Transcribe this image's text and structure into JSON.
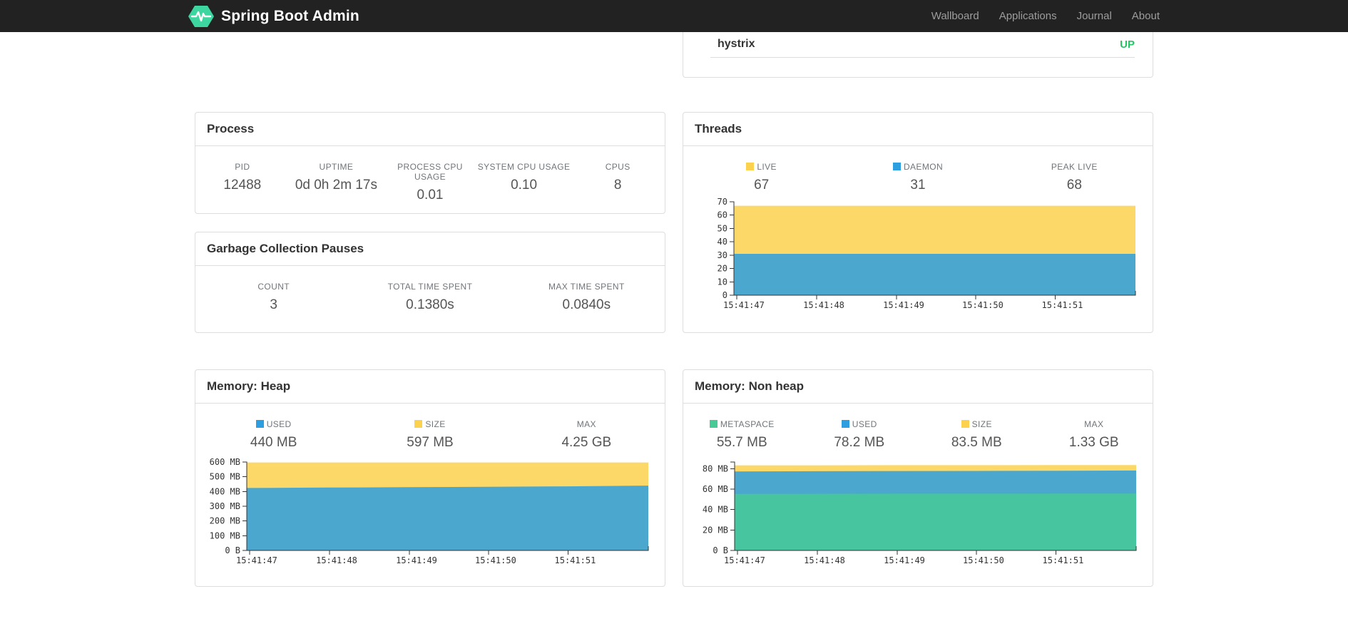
{
  "navbar": {
    "brand": "Spring Boot Admin",
    "items": [
      {
        "label": "Wallboard"
      },
      {
        "label": "Applications"
      },
      {
        "label": "Journal"
      },
      {
        "label": "About"
      }
    ]
  },
  "application_row": {
    "name": "hystrix",
    "status": "UP",
    "status_color": "#27C465"
  },
  "panels": {
    "process": {
      "title": "Process",
      "stats": [
        {
          "label": "PID",
          "value": "12488"
        },
        {
          "label": "UPTIME",
          "value": "0d 0h 2m 17s"
        },
        {
          "label": "PROCESS CPU USAGE",
          "value": "0.01"
        },
        {
          "label": "SYSTEM CPU USAGE",
          "value": "0.10"
        },
        {
          "label": "CPUS",
          "value": "8"
        }
      ]
    },
    "gc": {
      "title": "Garbage Collection Pauses",
      "stats": [
        {
          "label": "COUNT",
          "value": "3"
        },
        {
          "label": "TOTAL TIME SPENT",
          "value": "0.1380s"
        },
        {
          "label": "MAX TIME SPENT",
          "value": "0.0840s"
        }
      ]
    },
    "threads": {
      "title": "Threads",
      "stats": [
        {
          "label": "LIVE",
          "value": "67",
          "color": "#FBD14E"
        },
        {
          "label": "DAEMON",
          "value": "31",
          "color": "#2D9FE0"
        },
        {
          "label": "PEAK LIVE",
          "value": "68"
        }
      ]
    },
    "heap": {
      "title": "Memory: Heap",
      "stats": [
        {
          "label": "USED",
          "value": "440 MB",
          "color": "#2D9FE0"
        },
        {
          "label": "SIZE",
          "value": "597 MB",
          "color": "#FBD14E"
        },
        {
          "label": "MAX",
          "value": "4.25 GB"
        }
      ]
    },
    "nonheap": {
      "title": "Memory: Non heap",
      "stats": [
        {
          "label": "METASPACE",
          "value": "55.7 MB",
          "color": "#47CA95"
        },
        {
          "label": "USED",
          "value": "78.2 MB",
          "color": "#2D9FE0"
        },
        {
          "label": "SIZE",
          "value": "83.5 MB",
          "color": "#FBD14E"
        },
        {
          "label": "MAX",
          "value": "1.33 GB"
        }
      ]
    }
  },
  "chart_data": [
    {
      "id": "threads",
      "type": "area",
      "title": "Threads",
      "x_labels": [
        "15:41:47",
        "15:41:48",
        "15:41:49",
        "15:41:50",
        "15:41:51"
      ],
      "tick_fracs": [
        0.007,
        0.206,
        0.405,
        0.602,
        0.8
      ],
      "ylim": [
        0,
        70
      ],
      "yticks": [
        {
          "v": 0,
          "label": "0"
        },
        {
          "v": 10,
          "label": "10"
        },
        {
          "v": 20,
          "label": "20"
        },
        {
          "v": 30,
          "label": "30"
        },
        {
          "v": 40,
          "label": "40"
        },
        {
          "v": 50,
          "label": "50"
        },
        {
          "v": 60,
          "label": "60"
        },
        {
          "v": 70,
          "label": "70"
        }
      ],
      "grid": false,
      "legend_position": "above",
      "series": [
        {
          "name": "LIVE",
          "color": "#FBD14E",
          "values": [
            67,
            67,
            67,
            67,
            67,
            67
          ]
        },
        {
          "name": "DAEMON",
          "color": "#2D9FE0",
          "values": [
            31,
            31,
            31,
            31,
            31,
            31
          ]
        }
      ]
    },
    {
      "id": "heap",
      "type": "area",
      "title": "Memory: Heap",
      "x_labels": [
        "15:41:47",
        "15:41:48",
        "15:41:49",
        "15:41:50",
        "15:41:51"
      ],
      "tick_fracs": [
        0.007,
        0.206,
        0.405,
        0.602,
        0.8
      ],
      "ylim": [
        0,
        600
      ],
      "yticks": [
        {
          "v": 0,
          "label": "0 B"
        },
        {
          "v": 100,
          "label": "100 MB"
        },
        {
          "v": 200,
          "label": "200 MB"
        },
        {
          "v": 300,
          "label": "300 MB"
        },
        {
          "v": 400,
          "label": "400 MB"
        },
        {
          "v": 500,
          "label": "500 MB"
        },
        {
          "v": 600,
          "label": "600 MB"
        }
      ],
      "grid": false,
      "legend_position": "above",
      "series": [
        {
          "name": "SIZE",
          "color": "#FBD14E",
          "values": [
            597,
            597,
            597,
            597,
            597,
            597
          ]
        },
        {
          "name": "USED",
          "color": "#2D9FE0",
          "values": [
            424,
            427,
            429,
            432,
            435,
            440
          ]
        }
      ]
    },
    {
      "id": "nonheap",
      "type": "area",
      "title": "Memory: Non heap",
      "x_labels": [
        "15:41:47",
        "15:41:48",
        "15:41:49",
        "15:41:50",
        "15:41:51"
      ],
      "tick_fracs": [
        0.007,
        0.206,
        0.405,
        0.602,
        0.8
      ],
      "ylim": [
        0,
        86.5
      ],
      "yticks": [
        {
          "v": 0,
          "label": "0 B"
        },
        {
          "v": 20,
          "label": "20 MB"
        },
        {
          "v": 40,
          "label": "40 MB"
        },
        {
          "v": 60,
          "label": "60 MB"
        },
        {
          "v": 80,
          "label": "80 MB"
        }
      ],
      "grid": false,
      "legend_position": "above",
      "series": [
        {
          "name": "SIZE",
          "color": "#FBD14E",
          "values": [
            83.3,
            83.3,
            83.4,
            83.4,
            83.5,
            83.5
          ]
        },
        {
          "name": "USED",
          "color": "#2D9FE0",
          "values": [
            77.3,
            77.5,
            77.7,
            77.8,
            78.0,
            78.2
          ]
        },
        {
          "name": "METASPACE",
          "color": "#47CA95",
          "values": [
            55.3,
            55.4,
            55.5,
            55.5,
            55.6,
            55.7
          ]
        }
      ]
    }
  ]
}
